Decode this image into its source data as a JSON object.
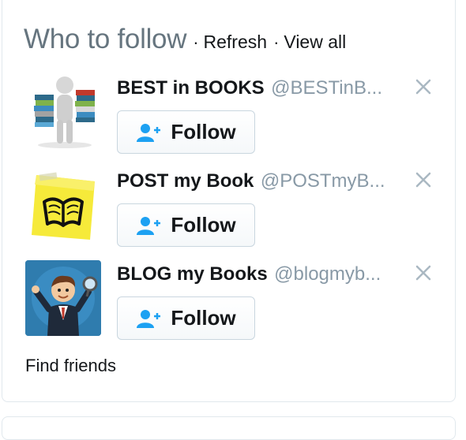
{
  "widget": {
    "title": "Who to follow",
    "separator": "·",
    "refresh_label": "Refresh",
    "view_all_label": "View all",
    "find_friends_label": "Find friends"
  },
  "suggestions": [
    {
      "name": "BEST in BOOKS",
      "handle": "@BESTinB...",
      "follow_label": "Follow",
      "avatar_icon": "person-holding-books-icon"
    },
    {
      "name": "POST my Book",
      "handle": "@POSTmyB...",
      "follow_label": "Follow",
      "avatar_icon": "open-book-sticky-note-icon"
    },
    {
      "name": "BLOG my Books",
      "handle": "@blogmyb...",
      "follow_label": "Follow",
      "avatar_icon": "businessman-magnifier-icon"
    }
  ],
  "colors": {
    "follow_icon": "#1da1f2",
    "handle_text": "#8899a6",
    "title_text": "#66757f",
    "border": "#e1e8ed"
  }
}
